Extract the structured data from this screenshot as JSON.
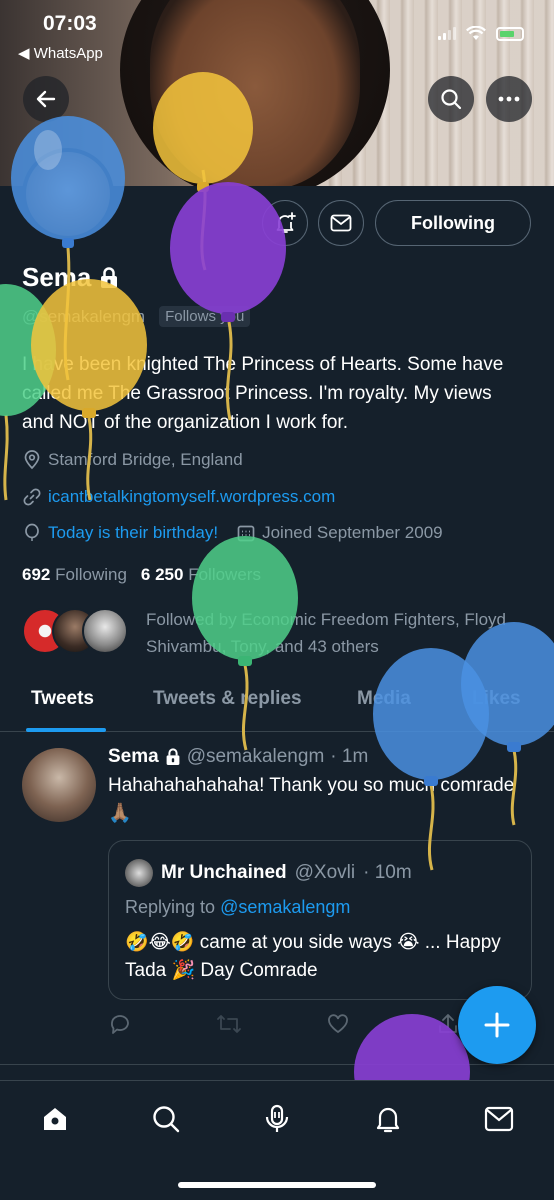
{
  "status_bar": {
    "time": "07:03",
    "back_app": "◀ WhatsApp"
  },
  "profile": {
    "name": "Sema",
    "handle": "@semakalengm",
    "follows_you": "Follows you",
    "follow_state": "Following",
    "bio": "I have been knighted The Princess of Hearts. Some have called me The Grassroot Princess. I'm royalty. My views and NOT of the organization I work for.",
    "location": "Stamford Bridge, England",
    "website": "icantbetalkingtomyself.wordpress.com",
    "birthday": "Today is their birthday!",
    "joined": "Joined September 2009",
    "following_count": "692",
    "following_label": "Following",
    "followers_count": "6 250",
    "followers_label": "Followers",
    "followed_by": "Followed by Economic Freedom Fighters, Floyd Shivambu, Tony, and 43 others"
  },
  "tabs": [
    {
      "label": "Tweets"
    },
    {
      "label": "Tweets & replies"
    },
    {
      "label": "Media"
    },
    {
      "label": "Likes"
    }
  ],
  "tweet": {
    "author": "Sema",
    "handle": "@semakalengm",
    "time": "· 1m",
    "text": "Hahahahahahaha! Thank you so much comrade 🙏🏽",
    "quote": {
      "author": "Mr Unchained",
      "handle": "@Xovli",
      "time": "· 10m",
      "replying_label": "Replying to",
      "replying_to": "@semakalengm",
      "text": "🤣😂🤣 came at you side ways 😭 ... Happy Tada 🎉 Day Comrade"
    }
  },
  "icons": {
    "back": "back-arrow-icon",
    "search": "search-icon",
    "more": "more-icon",
    "notify": "bell-plus-icon",
    "message": "mail-icon",
    "lock": "lock-icon"
  },
  "colors": {
    "background": "#15202b",
    "accent": "#1d9bf0",
    "secondary_text": "#8b98a5",
    "border": "#38444d"
  }
}
